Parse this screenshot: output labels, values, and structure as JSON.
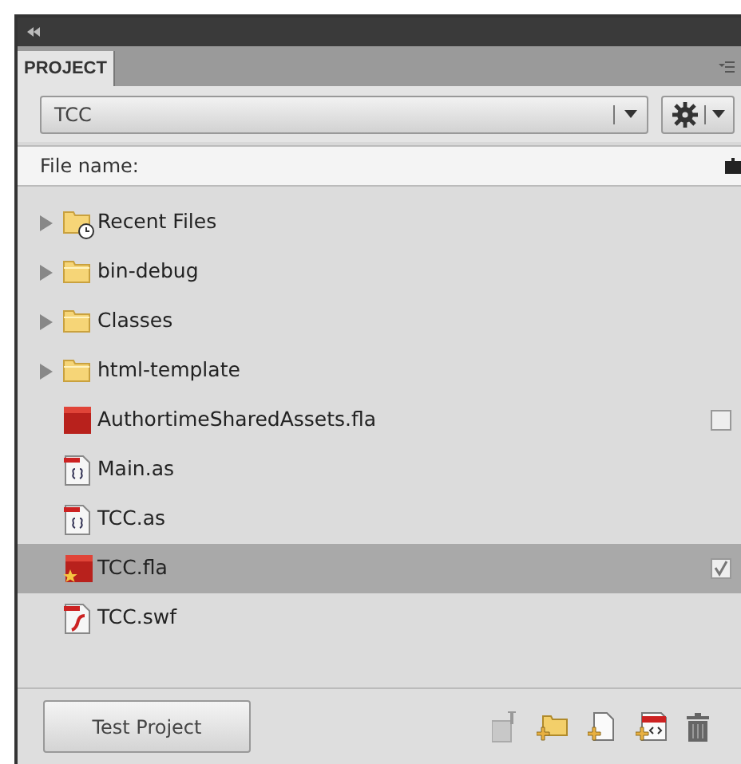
{
  "panel": {
    "tab": "PROJECT"
  },
  "project_select": {
    "value": "TCC"
  },
  "column_header": "File name:",
  "files": [
    {
      "name": "Recent Files",
      "kind": "recent",
      "expanded": false,
      "selected": false
    },
    {
      "name": "bin-debug",
      "kind": "folder",
      "expanded": false,
      "selected": false
    },
    {
      "name": "Classes",
      "kind": "folder",
      "expanded": false,
      "selected": false
    },
    {
      "name": "html-template",
      "kind": "folder",
      "expanded": false,
      "selected": false
    },
    {
      "name": "AuthortimeSharedAssets.fla",
      "kind": "fla",
      "checked": false,
      "selected": false
    },
    {
      "name": "Main.as",
      "kind": "as",
      "selected": false
    },
    {
      "name": "TCC.as",
      "kind": "as",
      "selected": false
    },
    {
      "name": "TCC.fla",
      "kind": "fla-main",
      "checked": true,
      "selected": true
    },
    {
      "name": "TCC.swf",
      "kind": "swf",
      "selected": false
    }
  ],
  "buttons": {
    "test": "Test Project"
  }
}
